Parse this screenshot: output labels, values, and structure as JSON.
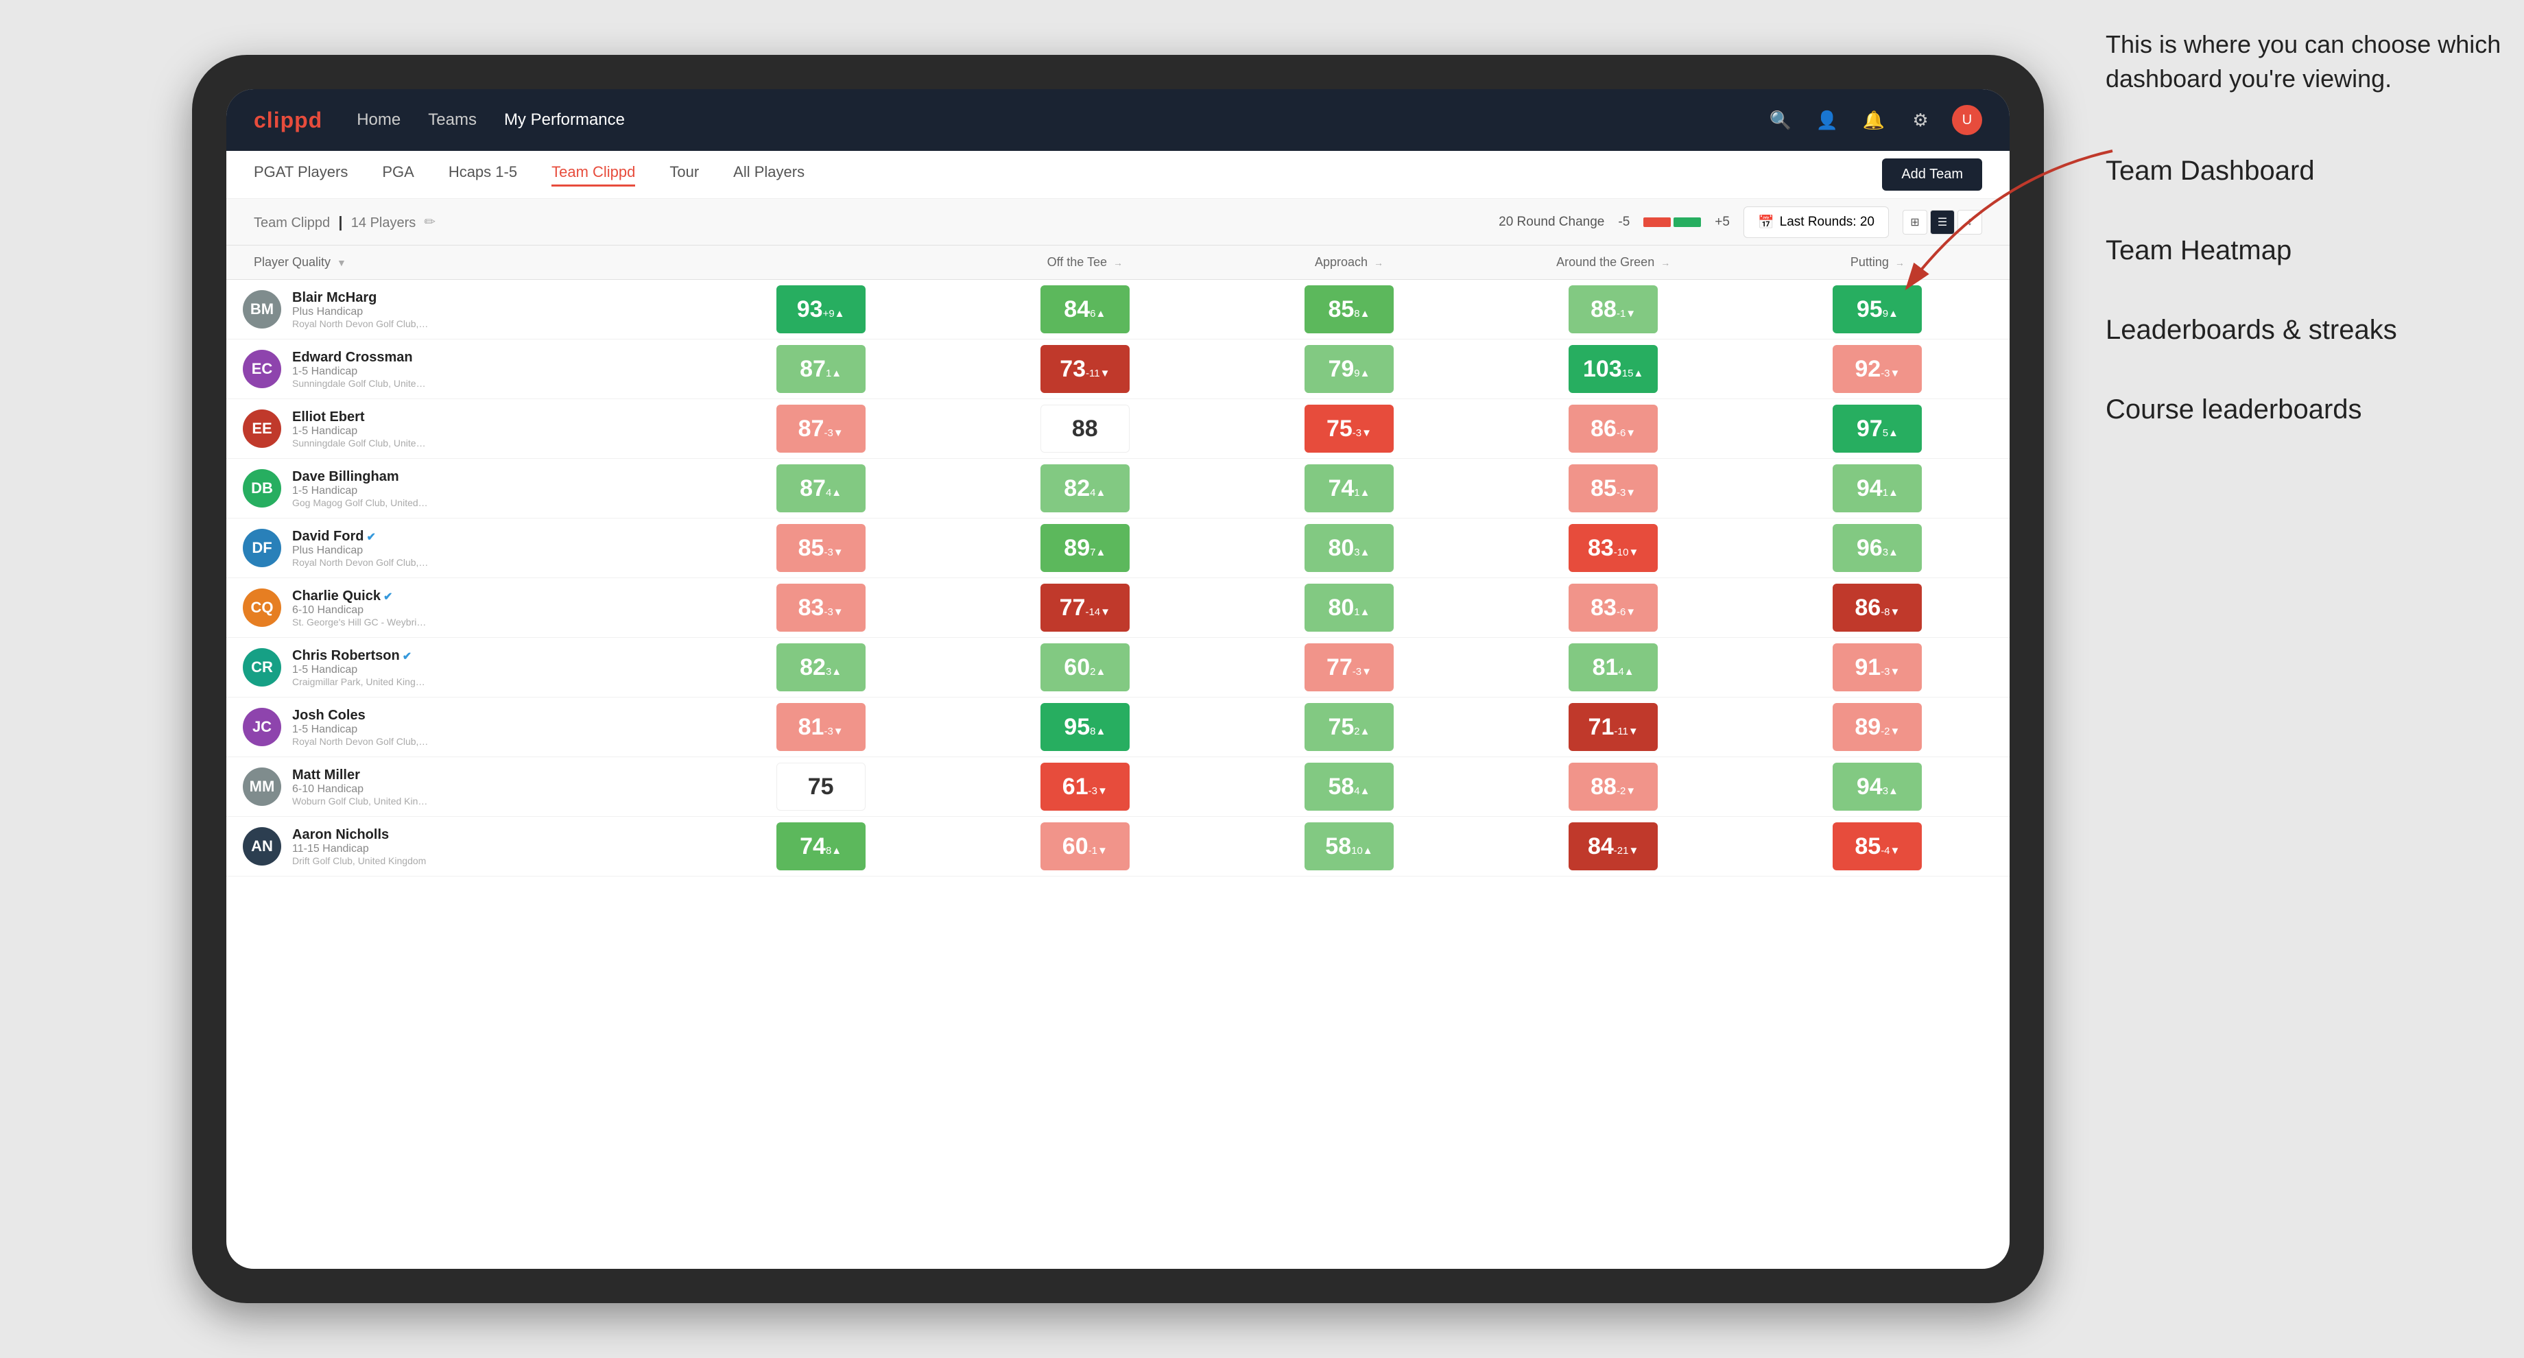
{
  "annotation": {
    "intro": "This is where you can choose which dashboard you're viewing.",
    "items": [
      "Team Dashboard",
      "Team Heatmap",
      "Leaderboards & streaks",
      "Course leaderboards"
    ]
  },
  "navbar": {
    "logo": "clippd",
    "links": [
      "Home",
      "Teams",
      "My Performance"
    ],
    "active_link": "My Performance"
  },
  "subnav": {
    "items": [
      "PGAT Players",
      "PGA",
      "Hcaps 1-5",
      "Team Clippd",
      "Tour",
      "All Players"
    ],
    "active_item": "Team Clippd",
    "add_team_label": "Add Team"
  },
  "team_header": {
    "title": "Team Clippd",
    "player_count": "14 Players",
    "round_change_label": "20 Round Change",
    "round_neg": "-5",
    "round_pos": "+5",
    "last_rounds_label": "Last Rounds: 20"
  },
  "table": {
    "headers": [
      "Player Quality ▼",
      "Off the Tee →",
      "Approach →",
      "Around the Green →",
      "Putting →"
    ],
    "players": [
      {
        "name": "Blair McHarg",
        "hcp": "Plus Handicap",
        "club": "Royal North Devon Golf Club, United Kingdom",
        "avatar_color": "#7f8c8d",
        "initials": "BM",
        "quality": {
          "score": 93,
          "change": "+9",
          "dir": "up",
          "color": "dark-green"
        },
        "tee": {
          "score": 84,
          "change": "6",
          "dir": "up",
          "color": "mid-green"
        },
        "approach": {
          "score": 85,
          "change": "8",
          "dir": "up",
          "color": "mid-green"
        },
        "around": {
          "score": 88,
          "change": "-1",
          "dir": "down",
          "color": "light-green"
        },
        "putting": {
          "score": 95,
          "change": "9",
          "dir": "up",
          "color": "dark-green"
        }
      },
      {
        "name": "Edward Crossman",
        "hcp": "1-5 Handicap",
        "club": "Sunningdale Golf Club, United Kingdom",
        "avatar_color": "#8e44ad",
        "initials": "EC",
        "quality": {
          "score": 87,
          "change": "1",
          "dir": "up",
          "color": "light-green"
        },
        "tee": {
          "score": 73,
          "change": "-11",
          "dir": "down",
          "color": "dark-red"
        },
        "approach": {
          "score": 79,
          "change": "9",
          "dir": "up",
          "color": "light-green"
        },
        "around": {
          "score": 103,
          "change": "15",
          "dir": "up",
          "color": "dark-green"
        },
        "putting": {
          "score": 92,
          "change": "-3",
          "dir": "down",
          "color": "light-red"
        }
      },
      {
        "name": "Elliot Ebert",
        "hcp": "1-5 Handicap",
        "club": "Sunningdale Golf Club, United Kingdom",
        "avatar_color": "#c0392b",
        "initials": "EE",
        "quality": {
          "score": 87,
          "change": "-3",
          "dir": "down",
          "color": "light-red"
        },
        "tee": {
          "score": 88,
          "change": "",
          "dir": "",
          "color": "white"
        },
        "approach": {
          "score": 75,
          "change": "-3",
          "dir": "down",
          "color": "mid-red"
        },
        "around": {
          "score": 86,
          "change": "-6",
          "dir": "down",
          "color": "light-red"
        },
        "putting": {
          "score": 97,
          "change": "5",
          "dir": "up",
          "color": "dark-green"
        }
      },
      {
        "name": "Dave Billingham",
        "hcp": "1-5 Handicap",
        "club": "Gog Magog Golf Club, United Kingdom",
        "avatar_color": "#27ae60",
        "initials": "DB",
        "quality": {
          "score": 87,
          "change": "4",
          "dir": "up",
          "color": "light-green"
        },
        "tee": {
          "score": 82,
          "change": "4",
          "dir": "up",
          "color": "light-green"
        },
        "approach": {
          "score": 74,
          "change": "1",
          "dir": "up",
          "color": "light-green"
        },
        "around": {
          "score": 85,
          "change": "-3",
          "dir": "down",
          "color": "light-red"
        },
        "putting": {
          "score": 94,
          "change": "1",
          "dir": "up",
          "color": "light-green"
        }
      },
      {
        "name": "David Ford",
        "hcp": "Plus Handicap",
        "club": "Royal North Devon Golf Club, United Kingdom",
        "avatar_color": "#2980b9",
        "initials": "DF",
        "verified": true,
        "quality": {
          "score": 85,
          "change": "-3",
          "dir": "down",
          "color": "light-red"
        },
        "tee": {
          "score": 89,
          "change": "7",
          "dir": "up",
          "color": "mid-green"
        },
        "approach": {
          "score": 80,
          "change": "3",
          "dir": "up",
          "color": "light-green"
        },
        "around": {
          "score": 83,
          "change": "-10",
          "dir": "down",
          "color": "mid-red"
        },
        "putting": {
          "score": 96,
          "change": "3",
          "dir": "up",
          "color": "light-green"
        }
      },
      {
        "name": "Charlie Quick",
        "hcp": "6-10 Handicap",
        "club": "St. George's Hill GC - Weybridge - Surrey, Uni...",
        "avatar_color": "#e67e22",
        "initials": "CQ",
        "verified": true,
        "quality": {
          "score": 83,
          "change": "-3",
          "dir": "down",
          "color": "light-red"
        },
        "tee": {
          "score": 77,
          "change": "-14",
          "dir": "down",
          "color": "dark-red"
        },
        "approach": {
          "score": 80,
          "change": "1",
          "dir": "up",
          "color": "light-green"
        },
        "around": {
          "score": 83,
          "change": "-6",
          "dir": "down",
          "color": "light-red"
        },
        "putting": {
          "score": 86,
          "change": "-8",
          "dir": "down",
          "color": "dark-red"
        }
      },
      {
        "name": "Chris Robertson",
        "hcp": "1-5 Handicap",
        "club": "Craigmillar Park, United Kingdom",
        "avatar_color": "#16a085",
        "initials": "CR",
        "verified": true,
        "quality": {
          "score": 82,
          "change": "3",
          "dir": "up",
          "color": "light-green"
        },
        "tee": {
          "score": 60,
          "change": "2",
          "dir": "up",
          "color": "light-green"
        },
        "approach": {
          "score": 77,
          "change": "-3",
          "dir": "down",
          "color": "light-red"
        },
        "around": {
          "score": 81,
          "change": "4",
          "dir": "up",
          "color": "light-green"
        },
        "putting": {
          "score": 91,
          "change": "-3",
          "dir": "down",
          "color": "light-red"
        }
      },
      {
        "name": "Josh Coles",
        "hcp": "1-5 Handicap",
        "club": "Royal North Devon Golf Club, United Kingdom",
        "avatar_color": "#8e44ad",
        "initials": "JC",
        "quality": {
          "score": 81,
          "change": "-3",
          "dir": "down",
          "color": "light-red"
        },
        "tee": {
          "score": 95,
          "change": "8",
          "dir": "up",
          "color": "dark-green"
        },
        "approach": {
          "score": 75,
          "change": "2",
          "dir": "up",
          "color": "light-green"
        },
        "around": {
          "score": 71,
          "change": "-11",
          "dir": "down",
          "color": "dark-red"
        },
        "putting": {
          "score": 89,
          "change": "-2",
          "dir": "down",
          "color": "light-red"
        }
      },
      {
        "name": "Matt Miller",
        "hcp": "6-10 Handicap",
        "club": "Woburn Golf Club, United Kingdom",
        "avatar_color": "#7f8c8d",
        "initials": "MM",
        "quality": {
          "score": 75,
          "change": "",
          "dir": "",
          "color": "white"
        },
        "tee": {
          "score": 61,
          "change": "-3",
          "dir": "down",
          "color": "mid-red"
        },
        "approach": {
          "score": 58,
          "change": "4",
          "dir": "up",
          "color": "light-green"
        },
        "around": {
          "score": 88,
          "change": "-2",
          "dir": "down",
          "color": "light-red"
        },
        "putting": {
          "score": 94,
          "change": "3",
          "dir": "up",
          "color": "light-green"
        }
      },
      {
        "name": "Aaron Nicholls",
        "hcp": "11-15 Handicap",
        "club": "Drift Golf Club, United Kingdom",
        "avatar_color": "#2c3e50",
        "initials": "AN",
        "quality": {
          "score": 74,
          "change": "8",
          "dir": "up",
          "color": "mid-green"
        },
        "tee": {
          "score": 60,
          "change": "-1",
          "dir": "down",
          "color": "light-red"
        },
        "approach": {
          "score": 58,
          "change": "10",
          "dir": "up",
          "color": "light-green"
        },
        "around": {
          "score": 84,
          "change": "-21",
          "dir": "down",
          "color": "dark-red"
        },
        "putting": {
          "score": 85,
          "change": "-4",
          "dir": "down",
          "color": "mid-red"
        }
      }
    ]
  },
  "colors": {
    "dark-green": "#27ae60",
    "mid-green": "#5cb85c",
    "light-green": "#82c982",
    "white": "#ffffff",
    "light-red": "#f1948a",
    "mid-red": "#e74c3c",
    "dark-red": "#c0392b",
    "navbar-bg": "#1a2332",
    "accent": "#e74c3c"
  }
}
